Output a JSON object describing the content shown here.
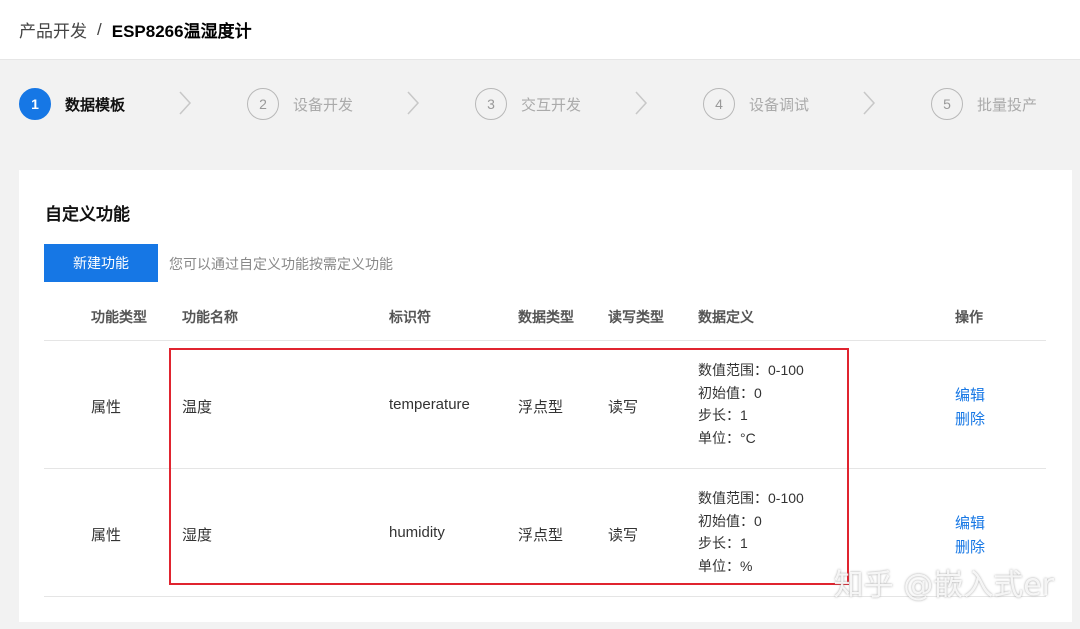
{
  "breadcrumb": {
    "parent": "产品开发",
    "separator": "/",
    "current": "ESP8266温湿度计"
  },
  "steps": [
    {
      "num": "1",
      "label": "数据模板",
      "active": true
    },
    {
      "num": "2",
      "label": "设备开发",
      "active": false
    },
    {
      "num": "3",
      "label": "交互开发",
      "active": false
    },
    {
      "num": "4",
      "label": "设备调试",
      "active": false
    },
    {
      "num": "5",
      "label": "批量投产",
      "active": false
    }
  ],
  "section": {
    "title": "自定义功能",
    "new_button": "新建功能",
    "hint": "您可以通过自定义功能按需定义功能"
  },
  "table": {
    "headers": [
      "功能类型",
      "功能名称",
      "标识符",
      "数据类型",
      "读写类型",
      "数据定义",
      "操作"
    ],
    "rows": [
      {
        "type": "属性",
        "name": "温度",
        "identifier": "temperature",
        "data_type": "浮点型",
        "rw": "读写",
        "definition": [
          "数值范围：0-100",
          "初始值：0",
          "步长：1",
          "单位：°C"
        ],
        "actions": [
          "编辑",
          "删除"
        ]
      },
      {
        "type": "属性",
        "name": "湿度",
        "identifier": "humidity",
        "data_type": "浮点型",
        "rw": "读写",
        "definition": [
          "数值范围：0-100",
          "初始值：0",
          "步长：1",
          "单位：%"
        ],
        "actions": [
          "编辑",
          "删除"
        ]
      }
    ]
  },
  "watermark": "知乎 @嵌入式er",
  "colors": {
    "accent": "#1677e5",
    "highlight_border": "#e0242f",
    "background": "#f2f2f2"
  }
}
